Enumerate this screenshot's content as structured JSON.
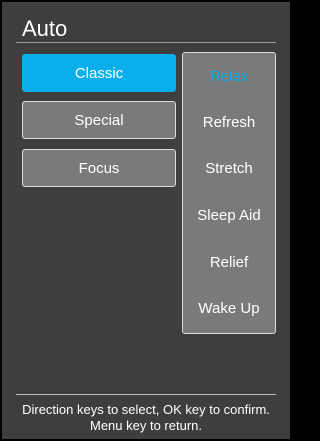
{
  "header": {
    "title": "Auto"
  },
  "modes": [
    {
      "label": "Classic",
      "selected": true
    },
    {
      "label": "Special",
      "selected": false
    },
    {
      "label": "Focus",
      "selected": false
    }
  ],
  "submenu": {
    "items": [
      {
        "label": "Relax",
        "selected": true
      },
      {
        "label": "Refresh",
        "selected": false
      },
      {
        "label": "Stretch",
        "selected": false
      },
      {
        "label": "Sleep Aid",
        "selected": false
      },
      {
        "label": "Relief",
        "selected": false
      },
      {
        "label": "Wake Up",
        "selected": false
      }
    ]
  },
  "footer": {
    "hint": "Direction keys to select, OK key to confirm. Menu key to return."
  },
  "colors": {
    "accent": "#0aaeea",
    "background": "#3e3e3e",
    "button": "#7a7a7a",
    "border": "#dcdcdc",
    "text": "#ffffff"
  }
}
